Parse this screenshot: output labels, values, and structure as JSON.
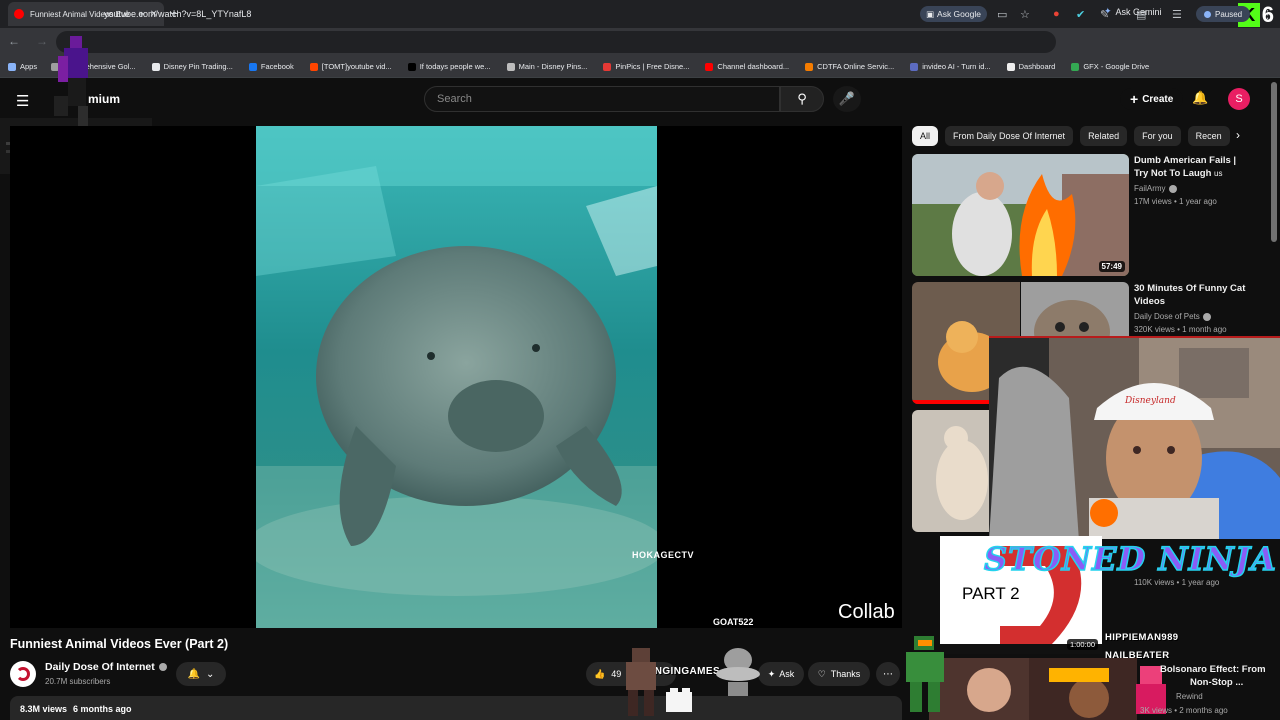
{
  "browser": {
    "tab_title": "Funniest Animal Videos Eve",
    "new_tab": "+",
    "gemini": "Ask Gemini",
    "url": "youtube.com/watch?v=8L_YTYnafL8",
    "ask_google": "Ask Google",
    "paused": "Paused",
    "overlay_number": "6",
    "bookmarks": [
      {
        "label": "Apps",
        "color": "#8ab4f8"
      },
      {
        "label": "Comprehensive Gol...",
        "color": "#9e9e9e"
      },
      {
        "label": "Disney Pin Trading...",
        "color": "#e8eaed"
      },
      {
        "label": "Facebook",
        "color": "#1877f2"
      },
      {
        "label": "[TOMT]youtube vid...",
        "color": "#ff4500"
      },
      {
        "label": "If todays people we...",
        "color": "#000000"
      },
      {
        "label": "Main - Disney Pins...",
        "color": "#bdbdbd"
      },
      {
        "label": "PinPics | Free Disne...",
        "color": "#e53935"
      },
      {
        "label": "Channel dashboard...",
        "color": "#ff0000"
      },
      {
        "label": "CDTFA Online Servic...",
        "color": "#f57c00"
      },
      {
        "label": "invideo AI - Turn id...",
        "color": "#5c6bc0"
      },
      {
        "label": "Dashboard",
        "color": "#eeeeee"
      },
      {
        "label": "GFX - Google Drive",
        "color": "#34a853"
      }
    ]
  },
  "youtube": {
    "logo_text": "mium",
    "search_placeholder": "Search",
    "create_label": "Create",
    "avatar_letter": "S"
  },
  "video": {
    "watermark": "HOKAGECTV",
    "overlay_user": "GOAT522",
    "collab_text": "Collab",
    "title": "Funniest Animal Videos Ever (Part 2)",
    "channel": "Daily Dose Of Internet",
    "subscribers": "20.7M subscribers",
    "likes": "49",
    "ask": "Ask",
    "thanks": "Thanks",
    "views": "8.3M views",
    "age": "6 months ago",
    "overlay_slinging": "SLINGINGAMES"
  },
  "chips": [
    "All",
    "From Daily Dose Of Internet",
    "Related",
    "For you",
    "Recen"
  ],
  "recommendations": [
    {
      "title": "Dumb American Fails | Try Not To Laugh",
      "badge": "us",
      "channel": "FailArmy",
      "meta": "17M views • 1 year ago",
      "duration": "57:49"
    },
    {
      "title": "30 Minutes Of Funny Cat Videos",
      "channel": "Daily Dose of Pets",
      "meta": "320K views • 1 month ago"
    },
    {
      "meta": "110K views • 1 year ago",
      "part_label": "PART 2",
      "duration": "1:00:00"
    },
    {
      "title_line1": "Bolsonaro Effect: From",
      "title_line2": "Non-Stop ...",
      "rewind": "Rewind",
      "meta": "3K views • 2 months ago"
    }
  ],
  "overlays": {
    "stoned_ninja": "STONED NINJA",
    "hippieman": "HIPPIEMAN989",
    "nailbeater": "NAILBEATER",
    "disneyland": "Disneyland"
  }
}
